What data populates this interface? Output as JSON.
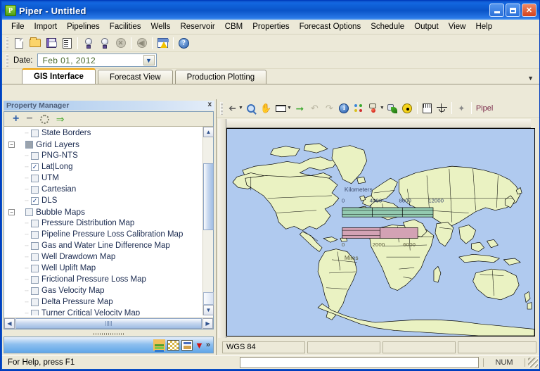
{
  "window": {
    "title": "Piper - Untitled",
    "app_icon": "P",
    "min_label": "Minimize",
    "max_label": "Maximize",
    "close_label": "Close"
  },
  "menu": {
    "items": [
      "File",
      "Import",
      "Pipelines",
      "Facilities",
      "Wells",
      "Reservoir",
      "CBM",
      "Properties",
      "Forecast Options",
      "Schedule",
      "Output",
      "View",
      "Help"
    ]
  },
  "toolbar": {
    "buttons": [
      {
        "name": "new-icon",
        "title": "New"
      },
      {
        "name": "open-folder-icon",
        "title": "Open"
      },
      {
        "name": "save-icon",
        "title": "Save"
      },
      {
        "name": "report-icon",
        "title": "Report"
      },
      {
        "name": "bulb-icon",
        "title": "Run"
      },
      {
        "name": "bulb-multi-icon",
        "title": "Run All"
      },
      {
        "name": "stop-icon",
        "title": "Stop"
      },
      {
        "name": "rewind-icon",
        "title": "Rewind"
      },
      {
        "name": "warning-report-icon",
        "title": "Warnings"
      },
      {
        "name": "help-icon",
        "title": "Help"
      }
    ]
  },
  "date_bar": {
    "label": "Date:",
    "value": "Feb  01, 2012",
    "dropdown_icon": "▼"
  },
  "tabs": {
    "items": [
      {
        "label": "GIS Interface",
        "active": true
      },
      {
        "label": "Forecast View",
        "active": false
      },
      {
        "label": "Production Plotting",
        "active": false
      }
    ],
    "overflow_icon": "▼"
  },
  "property_manager": {
    "caption": "Property Manager",
    "close_label": "x",
    "minibar": {
      "add_label": "+",
      "remove_label": "−",
      "settings_name": "gear-icon",
      "apply_label": "⇒"
    },
    "tree": [
      {
        "level": 2,
        "label": "State Borders",
        "checked": false,
        "type": "leaf"
      },
      {
        "level": 1,
        "label": "Grid Layers",
        "checked": "filled",
        "type": "group",
        "expanded": true
      },
      {
        "level": 2,
        "label": "PNG-NTS",
        "checked": false,
        "type": "leaf"
      },
      {
        "level": 2,
        "label": "Lat|Long",
        "checked": true,
        "type": "leaf"
      },
      {
        "level": 2,
        "label": "UTM",
        "checked": false,
        "type": "leaf"
      },
      {
        "level": 2,
        "label": "Cartesian",
        "checked": false,
        "type": "leaf"
      },
      {
        "level": 2,
        "label": "DLS",
        "checked": true,
        "type": "leaf"
      },
      {
        "level": 1,
        "label": "Bubble Maps",
        "checked": false,
        "type": "group",
        "expanded": true
      },
      {
        "level": 2,
        "label": "Pressure Distribution Map",
        "checked": false,
        "type": "leaf"
      },
      {
        "level": 2,
        "label": "Pipeline Pressure Loss Calibration Map",
        "checked": false,
        "type": "leaf"
      },
      {
        "level": 2,
        "label": "Gas and Water Line Difference Map",
        "checked": false,
        "type": "leaf"
      },
      {
        "level": 2,
        "label": "Well Drawdown Map",
        "checked": false,
        "type": "leaf"
      },
      {
        "level": 2,
        "label": "Well Uplift Map",
        "checked": false,
        "type": "leaf"
      },
      {
        "level": 2,
        "label": "Frictional Pressure Loss Map",
        "checked": false,
        "type": "leaf"
      },
      {
        "level": 2,
        "label": "Gas Velocity Map",
        "checked": false,
        "type": "leaf"
      },
      {
        "level": 2,
        "label": "Delta Pressure Map",
        "checked": false,
        "type": "leaf"
      },
      {
        "level": 2,
        "label": "Turner Critical Velocity Map",
        "checked": false,
        "type": "leaf"
      }
    ],
    "scroll_up_icon": "▲",
    "scroll_down_icon": "▼",
    "scroll_left_icon": "◀",
    "scroll_right_icon": "▶",
    "bottom_buttons": [
      {
        "name": "layers-icon",
        "title": "Layers"
      },
      {
        "name": "grid-icon",
        "title": "Grid"
      },
      {
        "name": "legend-icon",
        "title": "Legend"
      },
      {
        "name": "filter-funnel-icon",
        "title": "Filter"
      },
      {
        "name": "more-chevrons-icon",
        "title": "More",
        "label": "»"
      }
    ]
  },
  "map_toolbar": {
    "buttons": [
      {
        "name": "select-arrow-icon",
        "title": "Select"
      },
      {
        "name": "zoom-magnifier-icon",
        "title": "Zoom"
      },
      {
        "name": "pan-hand-icon",
        "title": "Pan"
      },
      {
        "name": "measure-ruler-icon",
        "title": "Measure"
      },
      {
        "name": "next-arrow-icon",
        "title": "Next"
      },
      {
        "name": "undo-icon",
        "title": "Undo"
      },
      {
        "name": "redo-icon",
        "title": "Redo"
      },
      {
        "name": "identify-info-icon",
        "title": "Identify"
      },
      {
        "name": "symbology-dots-icon",
        "title": "Symbology"
      },
      {
        "name": "bug-marker-icon",
        "title": "Marker"
      },
      {
        "name": "leaf-layer-icon",
        "title": "Layer Style"
      },
      {
        "name": "radiation-icon",
        "title": "Hazard"
      },
      {
        "name": "vertical-ruler-icon",
        "title": "Scale Ruler"
      },
      {
        "name": "balance-icon",
        "title": "Balance"
      },
      {
        "name": "sparkle-hand-icon",
        "title": "Effects"
      }
    ],
    "trailing_label": "Pipel"
  },
  "map": {
    "scalebar": {
      "top_title": "Kilometers",
      "top_ticks": [
        "0",
        "4000",
        "8000",
        "12000"
      ],
      "bottom_title": "Miles",
      "bottom_ticks": [
        "0",
        "2000",
        "6000"
      ],
      "top_color": "#93c9b0",
      "bottom_color": "#d3a2b4"
    },
    "water_color": "#b0caef",
    "land_color": "#eaf2c2",
    "status_cells": [
      {
        "name": "datum-cell",
        "value": "WGS 84"
      },
      {
        "name": "coord-x-cell",
        "value": ""
      },
      {
        "name": "coord-y-cell",
        "value": ""
      },
      {
        "name": "scale-cell",
        "value": ""
      }
    ]
  },
  "statusbar": {
    "help_text": "For Help, press F1",
    "input_value": "",
    "num_indicator": "NUM"
  }
}
